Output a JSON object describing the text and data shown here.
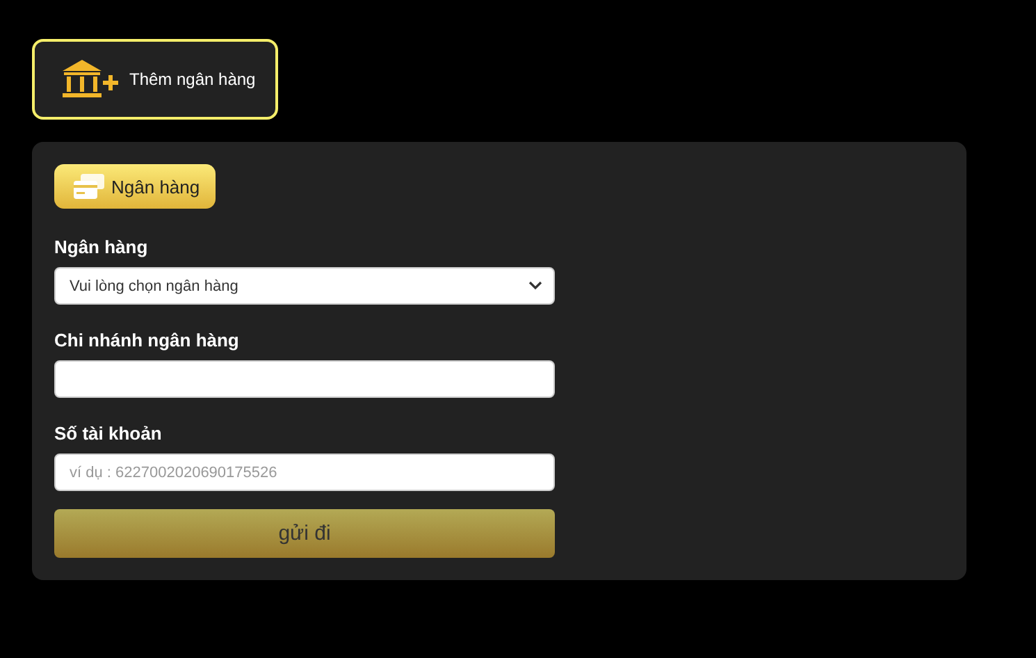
{
  "add_bank_button": {
    "label": "Thêm ngân hàng"
  },
  "tabs": [
    {
      "label": "Ngân hàng",
      "selected": true
    }
  ],
  "form": {
    "fields": [
      {
        "kind": "select",
        "label": "Ngân hàng",
        "value": "Vui lòng chọn ngân hàng"
      },
      {
        "kind": "text",
        "label": "Chi nhánh ngân hàng"
      },
      {
        "kind": "text",
        "label": "Số tài khoản",
        "placeholder": "ví dụ : 6227002020690175526"
      }
    ],
    "submit": "gửi đi"
  }
}
